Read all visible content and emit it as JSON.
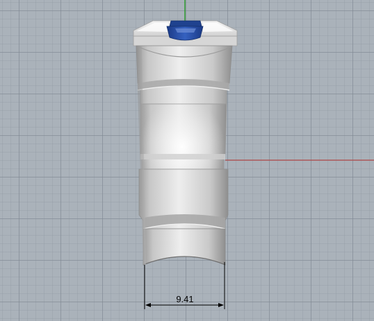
{
  "viewport": {
    "background_color": "#aab2ba",
    "grid_visible": true,
    "axes": {
      "x_axis_color": "#b04848",
      "y_axis_color": "#1c9a1c"
    }
  },
  "model": {
    "body_color": "#d8d8d8",
    "insert_color": "#2a4ea6"
  },
  "dimension": {
    "value": "9.41"
  }
}
